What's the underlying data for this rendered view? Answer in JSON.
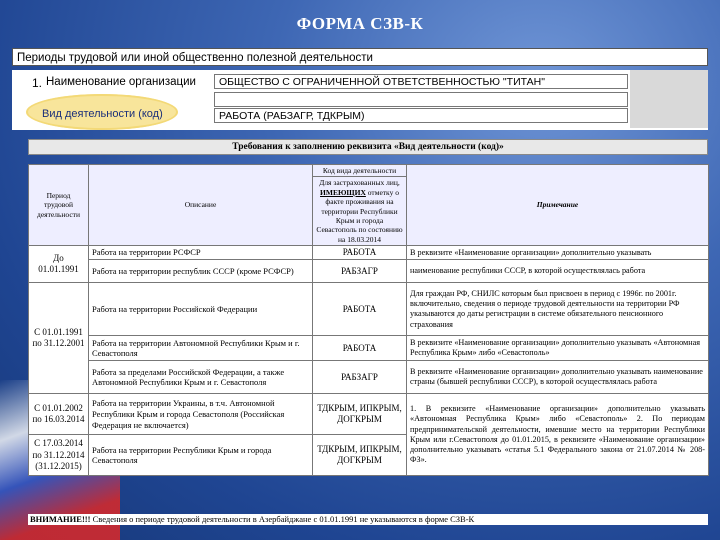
{
  "title": "ФОРМА СЗВ-К",
  "section_header": "Периоды трудовой или иной общественно полезной деятельности",
  "form": {
    "number": "1.",
    "org_label": "Наименование организации",
    "org_value": "ОБЩЕСТВО С ОГРАНИЧЕННОЙ ОТВЕТСТВЕННОСТЬЮ \"ТИТАН\"",
    "empty_row": "",
    "kind_label": "Вид деятельности (код)",
    "kind_value": "РАБОТА (РАБЗАГР, ТДКРЫМ)"
  },
  "requirements_title": "Требования к заполнению реквизита «Вид деятельности (код)»",
  "table": {
    "headers": {
      "period": "Период трудовой деятельности",
      "description": "Описание",
      "code_title": "Код вида деятельности",
      "code_sub_prefix": "Для застрахованных лиц,",
      "code_sub_emph": "ИМЕЮЩИХ",
      "code_sub_rest": "отметку о факте проживания на территории Республики Крым и города Севастополь по состоянию на 18.03.2014",
      "note": "Примечание"
    },
    "rows": [
      {
        "period": "До 01.01.1991",
        "desc": "Работа на территории РСФСР",
        "code": "РАБОТА",
        "note": "В реквизите «Наименование организации» дополнительно указывать"
      },
      {
        "desc": "Работа на территории республик СССР (кроме РСФСР)",
        "code": "РАБЗАГР",
        "note": "наименование республики СССР, в которой осуществлялась работа"
      },
      {
        "period": "С 01.01.1991 по 31.12.2001",
        "desc": "Работа на территории Российской Федерации",
        "code": "РАБОТА",
        "note": "Для граждан РФ, СНИЛС которым был присвоен в период с 1996г. по 2001г. включительно, сведения о периоде трудовой деятельности на территории РФ указываются до даты регистрации в системе обязательного пенсионного страхования"
      },
      {
        "desc": "Работа на территории Автономной Республики Крым и г. Севастополя",
        "code": "РАБОТА",
        "note": "В реквизите «Наименование организации» дополнительно указывать «Автономная Республика Крым» либо «Севастополь»"
      },
      {
        "desc": "Работа за пределами Российской Федерации, а также Автономной Республики Крым и г. Севастополя",
        "code": "РАБЗАГР",
        "note": "В реквизите «Наименование организации» дополнительно указывать наименование страны (бывшей республики СССР), в которой осуществлялась работа"
      },
      {
        "period": "С 01.01.2002 по 16.03.2014",
        "desc": "Работа на территории Украины, в т.ч. Автономной Республики Крым и города Севастополя (Российская Федерация не включается)",
        "code": "ТДКРЫМ, ИПКРЫМ, ДОГКРЫМ",
        "note": "1. В реквизите «Наименование организации» дополнительно указывать «Автономная Республика Крым» либо «Севастополь» 2. По периодам предпринимательской деятельности, имевшие место на территории Республики Крым или г.Севастополя до 01.01.2015, в реквизите «Наименование организации» дополнительно указывать «статья 5.1 Федерального закона от 21.07.2014 № 208-ФЗ»."
      },
      {
        "period": "С 17.03.2014 по 31.12.2014 (31.12.2015)",
        "desc": "Работа на территории Республики Крым и города Севастополя",
        "code": "ТДКРЫМ, ИПКРЫМ, ДОГКРЫМ"
      }
    ]
  },
  "warning": {
    "label": "ВНИМАНИЕ!!!",
    "text": "Сведения о периоде трудовой деятельности в Азербайджане с 01.01.1991 не указываются в форме СЗВ-К"
  },
  "colors": {
    "background": "#1f4592",
    "highlight": "#f8e59b"
  }
}
